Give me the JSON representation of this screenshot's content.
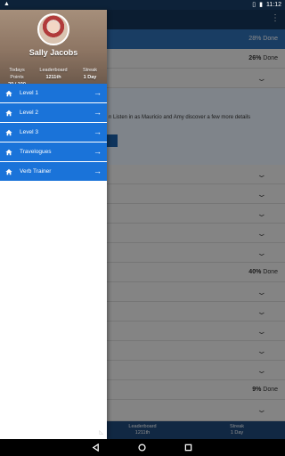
{
  "status_bar": {
    "time": "11:12"
  },
  "background": {
    "progress_rows": [
      {
        "value": "28%",
        "suffix": "Done"
      },
      {
        "value": "26%",
        "suffix": "Done"
      },
      {
        "value": "40%",
        "suffix": "Done"
      },
      {
        "value": "9%",
        "suffix": "Done"
      }
    ],
    "lesson_description": "n Listen in as Mauricio and Amy discover a few more details",
    "bottom_stats": [
      {
        "label": "Leaderboard",
        "value": "1211th"
      },
      {
        "label": "Streak",
        "value": "1 Day"
      }
    ]
  },
  "drawer": {
    "user_name": "Sally Jacobs",
    "stats": [
      {
        "label": "Todays Points",
        "value": "20 / 100"
      },
      {
        "label": "Leaderboard",
        "value": "1211th"
      },
      {
        "label": "Streak",
        "value": "1 Day"
      }
    ],
    "menu": [
      {
        "label": "Level 1"
      },
      {
        "label": "Level 2"
      },
      {
        "label": "Level 3"
      },
      {
        "label": "Travelogues"
      },
      {
        "label": "Verb Trainer"
      }
    ],
    "accent_color": "#1a73d9",
    "header_color": "#8d7563"
  },
  "colors": {
    "toolbar": "#15365a",
    "active_row": "#2f6fb5",
    "bottom_bar": "#1f4a7b"
  },
  "icons": [
    "alert-icon",
    "vibrate-icon",
    "battery-icon",
    "more-options-icon",
    "home-icon",
    "arrow-right-icon",
    "chevron-down-icon",
    "back-icon",
    "home-circle-icon",
    "recents-icon"
  ]
}
